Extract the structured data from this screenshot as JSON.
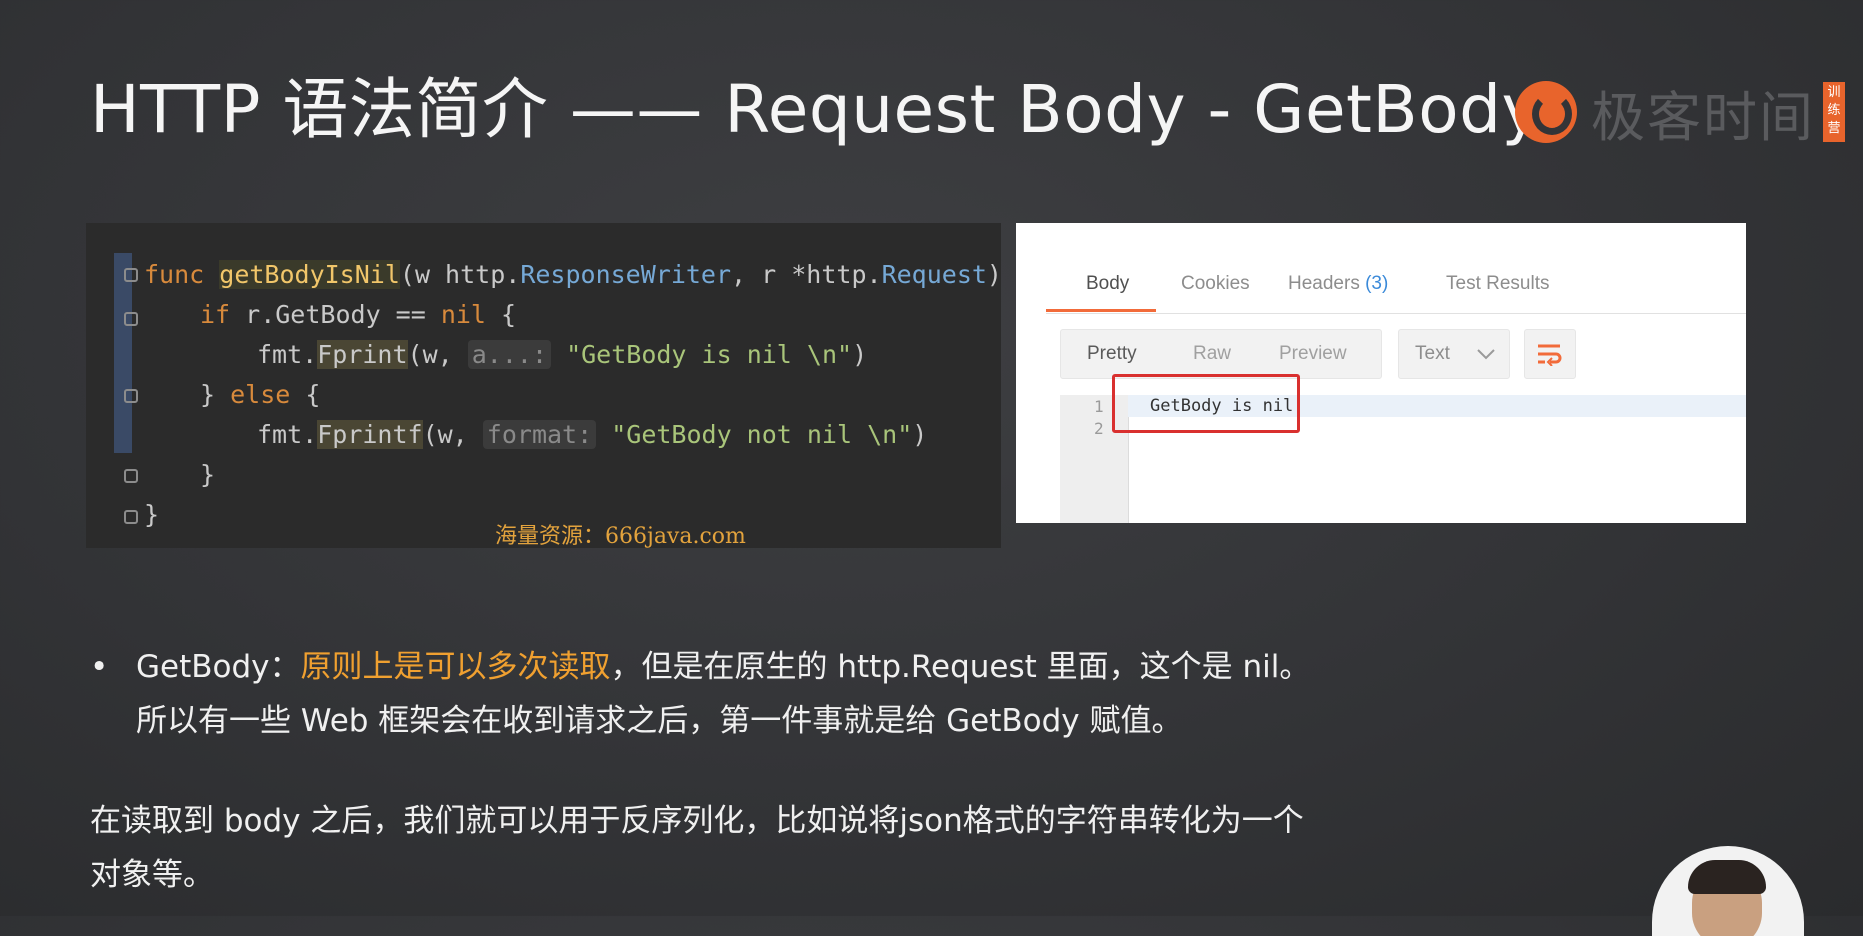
{
  "slide": {
    "title": "HTTP 语法简介 —— Request Body - GetBody",
    "logo": {
      "text": "极客时间",
      "tag": "训练营",
      "icon": "geektime-logo-icon"
    }
  },
  "code": {
    "lines": [
      {
        "parts": [
          "func ",
          "getBodyIsNil",
          "(w ",
          "http.",
          "ResponseWriter",
          ", r *",
          "http.",
          "Request",
          ") {"
        ]
      },
      {
        "parts": [
          "if ",
          "r.GetBody == ",
          "nil",
          " {"
        ]
      },
      {
        "parts": [
          "fmt.",
          "Fprint",
          "(w, ",
          "a...:",
          " ",
          "\"GetBody is nil \\n\"",
          ")"
        ]
      },
      {
        "parts": [
          "} ",
          "else",
          " {"
        ]
      },
      {
        "parts": [
          "fmt.",
          "Fprintf",
          "(w, ",
          "format:",
          " ",
          "\"GetBody not nil \\n\"",
          ")"
        ]
      },
      {
        "parts": [
          "}"
        ]
      },
      {
        "parts": [
          "}"
        ]
      }
    ],
    "watermark": "海量资源：666java.com"
  },
  "response_panel": {
    "tabs": [
      {
        "label": "Body",
        "active": true
      },
      {
        "label": "Cookies"
      },
      {
        "label": "Headers",
        "count": "(3)"
      },
      {
        "label": "Test Results"
      }
    ],
    "view_buttons": [
      "Pretty",
      "Raw",
      "Preview"
    ],
    "format": "Text",
    "line_numbers": [
      "1",
      "2"
    ],
    "body_text": "GetBody is nil"
  },
  "bullet": {
    "label": "GetBody：",
    "highlight": "原则上是可以多次读取",
    "rest_line1": "，但是在原生的 http.Request 里面，这个是 nil。",
    "line2": "所以有一些 Web 框架会在收到请求之后，第一件事就是给 GetBody 赋值。"
  },
  "paragraph": {
    "line1": "在读取到 body 之后，我们就可以用于反序列化，比如说将json格式的字符串转化为一个",
    "line2": "对象等。"
  }
}
